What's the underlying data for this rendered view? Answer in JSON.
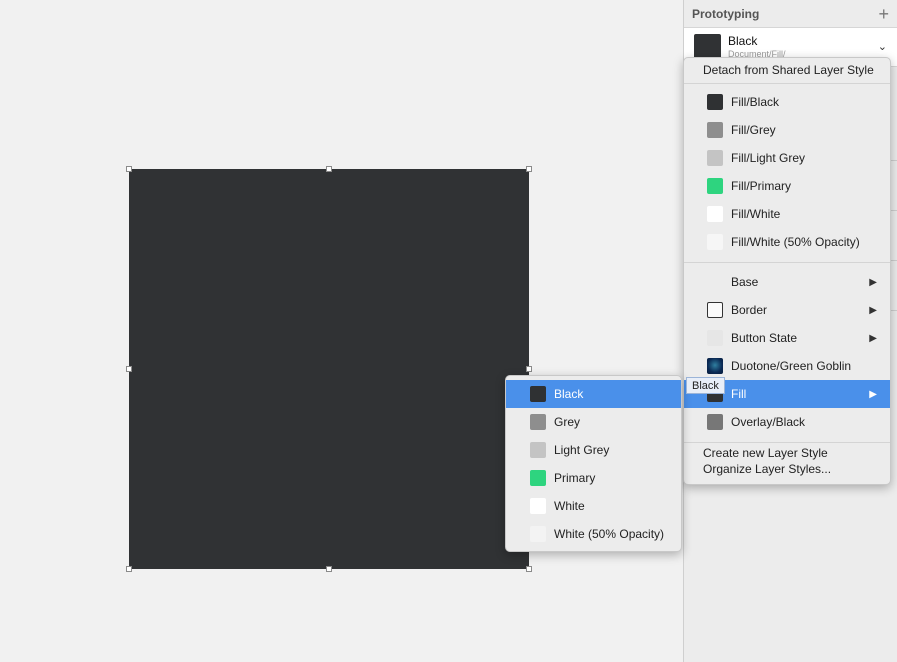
{
  "inspector": {
    "section_title": "Prototyping",
    "shared_style": {
      "name": "Black",
      "path": "Document/Fill/"
    }
  },
  "main_menu": {
    "detach_label": "Detach from Shared Layer Style",
    "fill_items": [
      {
        "label": "Fill/Black",
        "color": "#2f3133"
      },
      {
        "label": "Fill/Grey",
        "color": "#8e8e8e"
      },
      {
        "label": "Fill/Light Grey",
        "color": "#c4c4c4"
      },
      {
        "label": "Fill/Primary",
        "color": "#2ed47f"
      },
      {
        "label": "Fill/White",
        "color": "#ffffff"
      },
      {
        "label": "Fill/White (50% Opacity)",
        "color": "#f6f6f6"
      }
    ],
    "group_items": [
      {
        "label": "Base"
      },
      {
        "label": "Border"
      },
      {
        "label": "Button State"
      },
      {
        "label": "Duotone/Green Goblin"
      },
      {
        "label": "Fill"
      },
      {
        "label": "Overlay/Black"
      }
    ],
    "create_label": "Create new Layer Style",
    "organize_label": "Organize Layer Styles..."
  },
  "submenu": {
    "items": [
      {
        "label": "Black",
        "color": "#2f3133"
      },
      {
        "label": "Grey",
        "color": "#8e8e8e"
      },
      {
        "label": "Light Grey",
        "color": "#c4c4c4"
      },
      {
        "label": "Primary",
        "color": "#2ed47f"
      },
      {
        "label": "White",
        "color": "#ffffff"
      },
      {
        "label": "White (50% Opacity)",
        "color": "#f3f3f3"
      }
    ]
  },
  "tooltip": {
    "text": "Black"
  },
  "colors": {
    "highlight": "#4a90ea",
    "canvas_shape": "#303234"
  }
}
